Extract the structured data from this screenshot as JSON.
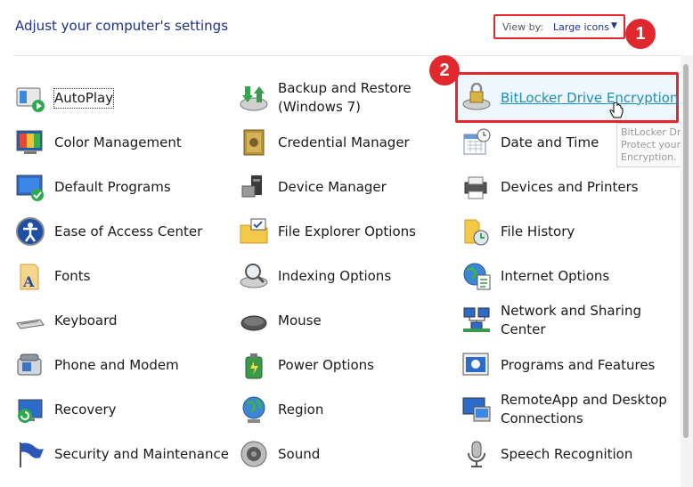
{
  "header": {
    "title": "Adjust your computer's settings",
    "view_by_label": "View by:",
    "view_by_value": "Large icons"
  },
  "annotations": [
    "1",
    "2"
  ],
  "accent_color": "#e0282e",
  "link_color": "#1e8fb8",
  "items": [
    {
      "label": "AutoPlay",
      "icon": "autoplay-icon"
    },
    {
      "label": "Backup and Restore (Windows 7)",
      "icon": "backup-restore-icon"
    },
    {
      "label": "BitLocker Drive Encryption",
      "icon": "bitlocker-icon"
    },
    {
      "label": "Color Management",
      "icon": "color-management-icon"
    },
    {
      "label": "Credential Manager",
      "icon": "credential-manager-icon"
    },
    {
      "label": "Date and Time",
      "icon": "date-time-icon"
    },
    {
      "label": "Default Programs",
      "icon": "default-programs-icon"
    },
    {
      "label": "Device Manager",
      "icon": "device-manager-icon"
    },
    {
      "label": "Devices and Printers",
      "icon": "devices-printers-icon"
    },
    {
      "label": "Ease of Access Center",
      "icon": "ease-of-access-icon"
    },
    {
      "label": "File Explorer Options",
      "icon": "file-explorer-options-icon"
    },
    {
      "label": "File History",
      "icon": "file-history-icon"
    },
    {
      "label": "Fonts",
      "icon": "fonts-icon"
    },
    {
      "label": "Indexing Options",
      "icon": "indexing-options-icon"
    },
    {
      "label": "Internet Options",
      "icon": "internet-options-icon"
    },
    {
      "label": "Keyboard",
      "icon": "keyboard-icon"
    },
    {
      "label": "Mouse",
      "icon": "mouse-icon"
    },
    {
      "label": "Network and Sharing Center",
      "icon": "network-sharing-icon"
    },
    {
      "label": "Phone and Modem",
      "icon": "phone-modem-icon"
    },
    {
      "label": "Power Options",
      "icon": "power-options-icon"
    },
    {
      "label": "Programs and Features",
      "icon": "programs-features-icon"
    },
    {
      "label": "Recovery",
      "icon": "recovery-icon"
    },
    {
      "label": "Region",
      "icon": "region-icon"
    },
    {
      "label": "RemoteApp and Desktop Connections",
      "icon": "remoteapp-icon"
    },
    {
      "label": "Security and Maintenance",
      "icon": "security-maintenance-icon"
    },
    {
      "label": "Sound",
      "icon": "sound-icon"
    },
    {
      "label": "Speech Recognition",
      "icon": "speech-recognition-icon"
    }
  ],
  "tooltip": [
    "BitLocker Drive E",
    "Protect your PC",
    "Encryption."
  ]
}
